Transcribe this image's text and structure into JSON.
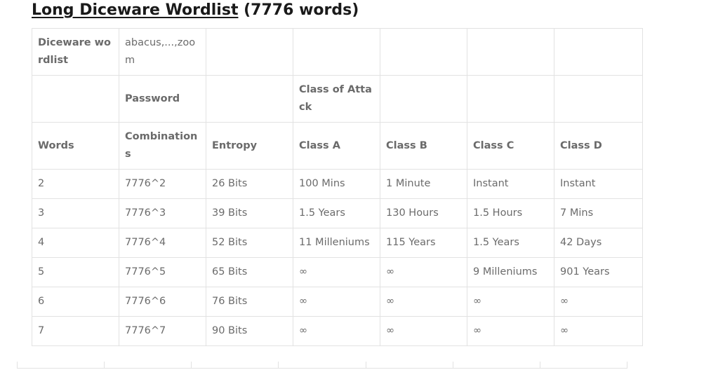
{
  "heading": {
    "link_text": "Long Diceware Wordlist",
    "rest": " (7776 words)"
  },
  "table": {
    "row1": [
      "Diceware wordlist",
      "abacus,...,zoom",
      "",
      "",
      "",
      "",
      ""
    ],
    "row2": [
      "",
      "Password",
      "",
      "Class of Attack",
      "",
      "",
      ""
    ],
    "header": [
      "Words",
      "Combinations",
      "Entropy",
      "Class A",
      "Class B",
      "Class C",
      "Class D"
    ],
    "rows": [
      [
        "2",
        "7776^2",
        "26 Bits",
        "100 Mins",
        "1 Minute",
        "Instant",
        "Instant"
      ],
      [
        "3",
        "7776^3",
        "39 Bits",
        "1.5 Years",
        "130 Hours",
        "1.5 Hours",
        "7 Mins"
      ],
      [
        "4",
        "7776^4",
        "52 Bits",
        "11 Milleniums",
        "115 Years",
        "1.5 Years",
        "42 Days"
      ],
      [
        "5",
        "7776^5",
        "65 Bits",
        "∞",
        "∞",
        "9 Milleniums",
        "901 Years"
      ],
      [
        "6",
        "7776^6",
        "76 Bits",
        "∞",
        "∞",
        "∞",
        "∞"
      ],
      [
        "7",
        "7776^7",
        "90 Bits",
        "∞",
        "∞",
        "∞",
        "∞"
      ]
    ]
  }
}
